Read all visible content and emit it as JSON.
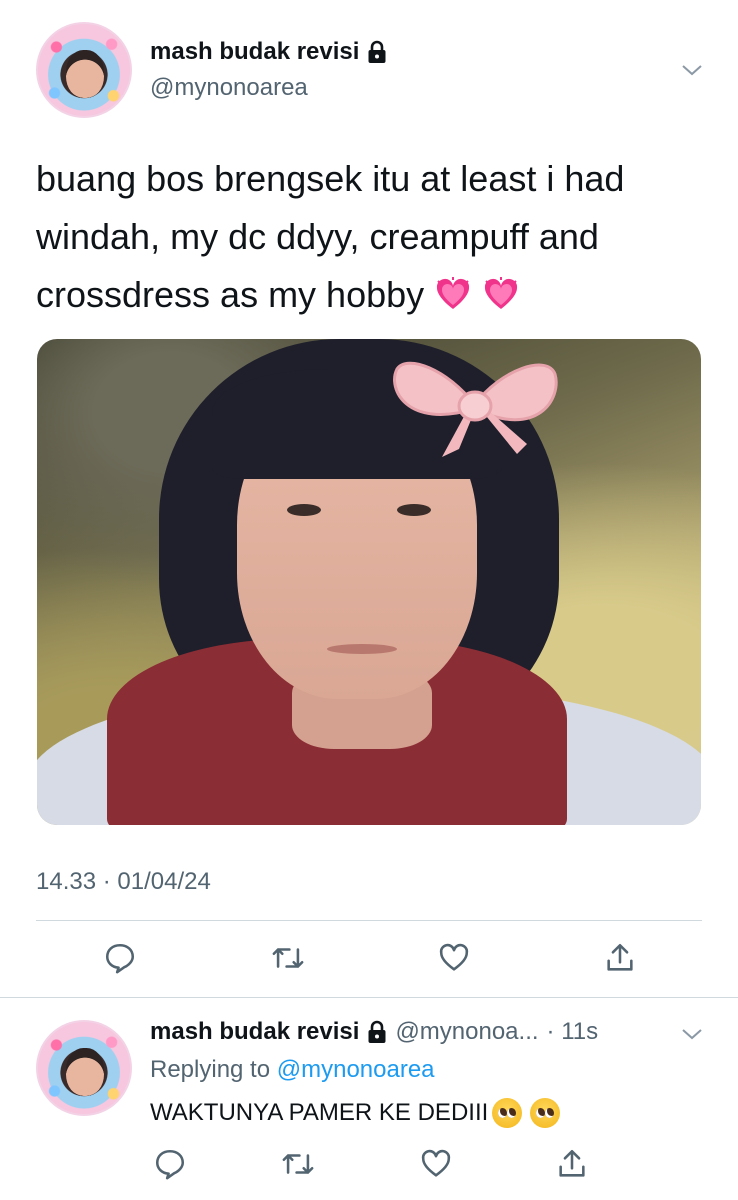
{
  "main_tweet": {
    "display_name": "mash budak revisi",
    "handle": "@mynonoarea",
    "text": "buang bos brengsek itu at least i had windah, my dc ddyy, creampuff and crossdress as my hobby",
    "text_emojis": [
      "growing-heart-icon",
      "growing-heart-icon"
    ],
    "timestamp": "14.33 · 01/04/24",
    "actions": [
      "reply-icon",
      "retweet-icon",
      "like-icon",
      "share-icon"
    ]
  },
  "reply_tweet": {
    "display_name": "mash budak revisi",
    "handle": "@mynonoa...",
    "time": "· 11s",
    "replying_prefix": "Replying to",
    "replying_to": "@mynonoarea",
    "text": "WAKTUNYA PAMER KE DEDIII",
    "text_emojis": [
      "pleading-face-icon",
      "pleading-face-icon"
    ],
    "actions": [
      "reply-icon",
      "retweet-icon",
      "like-icon",
      "share-icon"
    ]
  },
  "colors": {
    "text": "#0f1419",
    "secondary": "#536471",
    "link": "#1d9bf0",
    "divider": "#cfd9de"
  }
}
